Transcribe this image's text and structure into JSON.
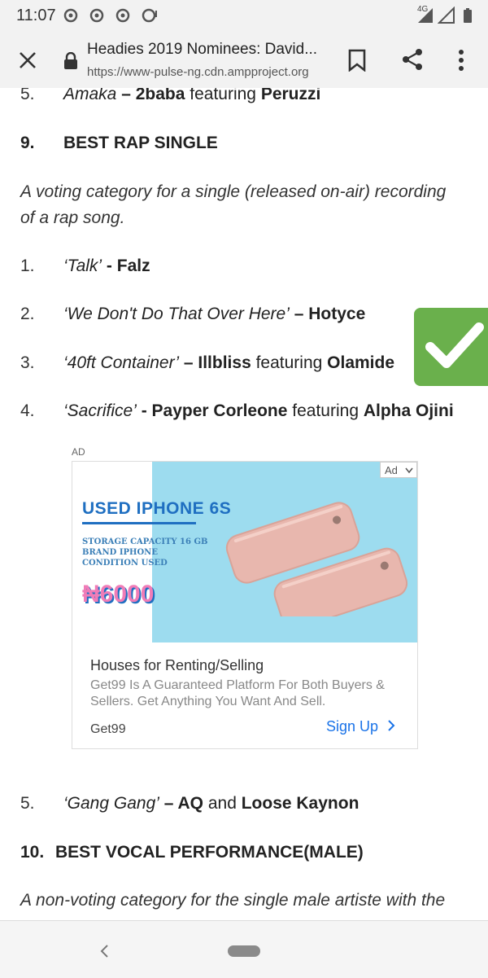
{
  "status_bar": {
    "time": "11:07",
    "network": "4G"
  },
  "browser": {
    "page_title": "Headies 2019 Nominees: David...",
    "url": "https://www-pulse-ng.cdn.ampproject.org"
  },
  "article": {
    "prev_item": {
      "number": "5.",
      "song": "Amaka",
      "dash": " – ",
      "artist": "2baba",
      "featuring": " featuring ",
      "feat_artist": "Peruzzi"
    },
    "section9": {
      "number": "9.",
      "heading": "BEST RAP SINGLE",
      "description_line1": "A voting category for a single (released on-air) recording",
      "description_line2": "of a rap song.",
      "items": [
        {
          "number": "1.",
          "song": "‘Talk’",
          "dash": " - ",
          "artist": "Falz"
        },
        {
          "number": "2.",
          "song": "‘We Don't Do That Over Here’",
          "dash": " – ",
          "artist": "Hotyce"
        },
        {
          "number": "3.",
          "song": "‘40ft Container’",
          "dash": " – ",
          "artist": "Illbliss",
          "featuring": " featuring ",
          "feat_artist": "Olamide"
        },
        {
          "number": "4.",
          "song": "‘Sacrifice’",
          "dash": " - ",
          "artist": "Payper Corleone",
          "featuring": " featuring ",
          "feat_artist": "Alpha Ojini"
        },
        {
          "number": "5.",
          "song": "‘Gang Gang’",
          "dash": " – ",
          "artist": "AQ",
          "and": " and ",
          "artist2": "Loose Kaynon"
        }
      ]
    },
    "section10": {
      "number": "10.",
      "heading": "BEST VOCAL PERFORMANCE(MALE)",
      "description_line1": "A non-voting category for the single male artiste with the"
    }
  },
  "ad": {
    "label": "AD",
    "choices": "Ad",
    "banner_title": "USED IPHONE 6S",
    "spec_line1": "STORAGE CAPACITY  16 GB",
    "spec_line2": "BRAND     IPHONE",
    "spec_line3": "CONDITION USED",
    "price": "₦6000",
    "headline": "Houses for Renting/Selling",
    "body_line1": "Get99 Is A Guaranteed Platform For Both Buyers &",
    "body_line2": "Sellers. Get Anything You Want And Sell.",
    "advertiser": "Get99",
    "cta": "Sign Up"
  },
  "colors": {
    "check_badge": "#6ab04c",
    "ad_cyan": "#9ddcef",
    "ad_blue": "#1f6fc1",
    "price_pink": "#f07cb7",
    "cta_blue": "#1a73e8"
  }
}
